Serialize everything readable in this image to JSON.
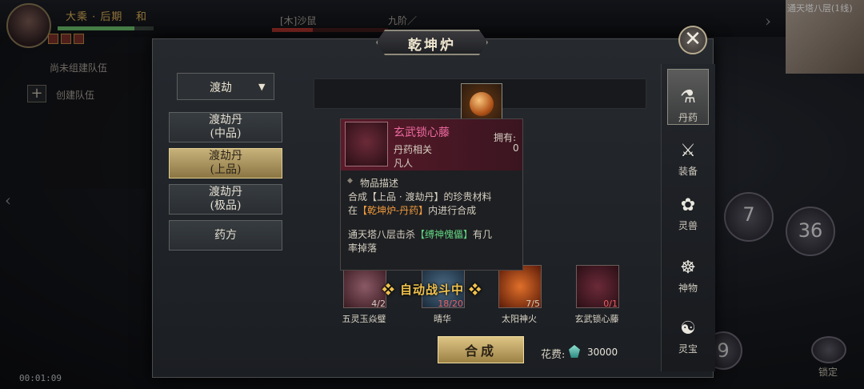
{
  "hud": {
    "realm_left": "大乘 · 后期",
    "realm_right": "和",
    "mob_name": "[木]沙鼠",
    "mob_level": "九阶／",
    "team_none": "尚未组建队伍",
    "team_create": "创建队伍",
    "team_plus": "+",
    "minimap_title": "通天塔八层(1线)",
    "clock": "00:01:09",
    "skill_numbers": [
      "7",
      "36",
      "9"
    ],
    "lock_label": "锁定",
    "side_arrow_left": "‹",
    "side_arrow_right": "›"
  },
  "dialog": {
    "title": "乾坤炉",
    "close_symbol": "✕",
    "dropdown": {
      "label": "渡劫",
      "arrow": "▼"
    },
    "categories": [
      {
        "label": "渡劫丹\n(中品)",
        "active": false
      },
      {
        "label": "渡劫丹\n(上品)",
        "active": true
      },
      {
        "label": "渡劫丹\n(极品)",
        "active": false
      },
      {
        "label": "药方",
        "active": false
      }
    ],
    "auto_battle": "❖ 自动战斗中 ❖",
    "materials": [
      {
        "name": "五灵玉焱璧",
        "qty": "4/2",
        "icon": "jade-icon"
      },
      {
        "name": "晴华",
        "qty": "18/20",
        "icon": "crystal-icon"
      },
      {
        "name": "太阳神火",
        "qty": "7/5",
        "icon": "fire-icon"
      },
      {
        "name": "玄武锁心藤",
        "qty": "0/1",
        "icon": "vine-icon"
      }
    ],
    "combine_button": "合成",
    "cost_label": "花费:",
    "cost_value": "30000"
  },
  "tabs": [
    {
      "label": "丹药",
      "icon": "pill-bowl-icon",
      "glyph": "⚗",
      "active": true
    },
    {
      "label": "装备",
      "icon": "sword-icon",
      "glyph": "⚔",
      "active": false
    },
    {
      "label": "灵兽",
      "icon": "paw-icon",
      "glyph": "✿",
      "active": false
    },
    {
      "label": "神物",
      "icon": "fan-icon",
      "glyph": "☸",
      "active": false
    },
    {
      "label": "灵宝",
      "icon": "orb-icon",
      "glyph": "☯",
      "active": false
    }
  ],
  "tooltip": {
    "name": "玄武锁心藤",
    "type": "丹药相关",
    "rank": "凡人",
    "owned_label": "拥有:",
    "owned_value": "0",
    "section_title": "物品描述",
    "desc_a1": "合成【上品 · 渡劫丹】的珍贵材料",
    "desc_a2_pre": "在",
    "desc_a2_hl": "【乾坤炉-丹药】",
    "desc_a2_post": "内进行合成",
    "desc_b_pre": "通天塔八层击杀",
    "desc_b_hl": "【缚神傀儡】",
    "desc_b_post": "有几",
    "desc_b2": "率掉落"
  },
  "colors": {
    "accent_gold": "#e0b45a",
    "item_rare_pink": "#ef6aa0",
    "highlight_orange": "#f09a3e",
    "highlight_green": "#5fd07e"
  }
}
